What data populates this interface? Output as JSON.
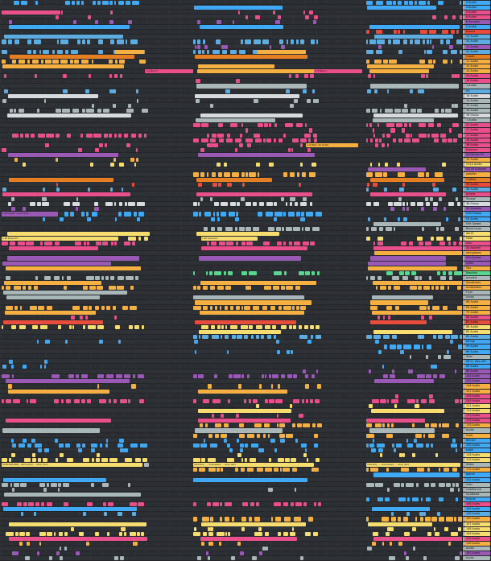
{
  "tracks": [
    {
      "name": "3 Audio",
      "color": "#3fa9f5"
    },
    {
      "name": "4 Audio",
      "color": "#3fa9f5"
    },
    {
      "name": "5 Audio",
      "color": "#e94f8a"
    },
    {
      "name": "6 Audio",
      "color": "#e94f8a"
    },
    {
      "name": "8 Sampler",
      "color": "#9b59b6"
    },
    {
      "name": "5 Audio",
      "color": "#3fa9f5"
    },
    {
      "name": "Drums",
      "color": "#e74c3c"
    },
    {
      "name": "10 Audio",
      "color": "#5dade2"
    },
    {
      "name": "14 Audio",
      "color": "#5dade2"
    },
    {
      "name": "12 Audio",
      "color": "#9b59b6"
    },
    {
      "name": "12 Audio",
      "color": "#5dade2"
    },
    {
      "name": "rvsper",
      "color": "#e67e22"
    },
    {
      "name": "11 Audio",
      "color": "#f5b041"
    },
    {
      "name": "13 Audio",
      "color": "#f5b041"
    },
    {
      "name": "14 Audio",
      "color": "#f5b041"
    },
    {
      "name": "15 Audio",
      "color": "#e94f8a"
    },
    {
      "name": "16 Audio",
      "color": "#e94f8a"
    },
    {
      "name": "1-Audio",
      "color": "#aab7b8"
    },
    {
      "name": "Hh",
      "color": "#5dade2"
    },
    {
      "name": "16 Audio",
      "color": "#d7dbdd"
    },
    {
      "name": "14 Audio",
      "color": "#aab7b8"
    },
    {
      "name": "15 Audio",
      "color": "#aab7b8"
    },
    {
      "name": "16 Audio",
      "color": "#aab7b8"
    },
    {
      "name": "16 Group",
      "color": "#d7dbdd"
    },
    {
      "name": "1 Audio",
      "color": "#aab7b8"
    },
    {
      "name": "22 Audio",
      "color": "#e94f8a"
    },
    {
      "name": "17 Audio",
      "color": "#e94f8a"
    },
    {
      "name": "17 Audio",
      "color": "#e94f8a"
    },
    {
      "name": "18 Audio",
      "color": "#e94f8a"
    },
    {
      "name": "36 Audio",
      "color": "#e94f8a"
    },
    {
      "name": "Anamnu",
      "color": "#e94f8a"
    },
    {
      "name": "24 Drums Ell",
      "color": "#9b59b6"
    },
    {
      "name": "19 Audio",
      "color": "#f5b041"
    },
    {
      "name": "Ch10 Audio",
      "color": "#f7dc6f"
    },
    {
      "name": "SN 34 Autosite",
      "color": "#9b59b6"
    },
    {
      "name": "pad/ber",
      "color": "#f5b041"
    },
    {
      "name": "OutPad",
      "color": "#e67e22"
    },
    {
      "name": "33 Audio",
      "color": "#e74c3c"
    },
    {
      "name": "36 Audio",
      "color": "#5dade2"
    },
    {
      "name": "Amplis",
      "color": "#e94f8a"
    },
    {
      "name": "Sinage",
      "color": "#aab7b8"
    },
    {
      "name": "36 Group",
      "color": "#d7dbdd"
    },
    {
      "name": "36 Sampler",
      "color": "#9b59b6"
    },
    {
      "name": "Mild Sweep",
      "color": "#3fa9f5"
    },
    {
      "name": "53 Audio",
      "color": "#3fa9f5"
    },
    {
      "name": "Edit Sweps",
      "color": "#aab7b8"
    },
    {
      "name": "Black Lines",
      "color": "#aab7b8"
    },
    {
      "name": "Xel15",
      "color": "#f7dc6f"
    },
    {
      "name": "Hate",
      "color": "#f7dc6f"
    },
    {
      "name": "Snin",
      "color": "#e94f8a"
    },
    {
      "name": "34 Asthmil",
      "color": "#e94f8a"
    },
    {
      "name": "stringdown",
      "color": "#f5b041"
    },
    {
      "name": "Hor-Syntes",
      "color": "#9b59b6"
    },
    {
      "name": "synth",
      "color": "#9b59b6"
    },
    {
      "name": "Sax",
      "color": "#f5b041"
    },
    {
      "name": "Bassline",
      "color": "#58d68d"
    },
    {
      "name": "preview",
      "color": "#aab7b8"
    },
    {
      "name": "Sandtunes",
      "color": "#f5b041"
    },
    {
      "name": "Audiovision",
      "color": "#f5b041"
    },
    {
      "name": "Flyer",
      "color": "#aab7b8"
    },
    {
      "name": "Audio",
      "color": "#aab7b8"
    },
    {
      "name": "8B Audio",
      "color": "#f5b041"
    },
    {
      "name": "69 Audio",
      "color": "#f5b041"
    },
    {
      "name": "79 Audio",
      "color": "#f5b041"
    },
    {
      "name": "88 Audio",
      "color": "#e94f8a"
    },
    {
      "name": "82 Audio",
      "color": "#e74c3c"
    },
    {
      "name": "88 Audio",
      "color": "#f7dc6f"
    },
    {
      "name": "83 Audio",
      "color": "#f7dc6f"
    },
    {
      "name": "82 Audio",
      "color": "#5dade2"
    },
    {
      "name": "tempo",
      "color": "#3fa9f5"
    },
    {
      "name": "90 Audio",
      "color": "#3fa9f5"
    },
    {
      "name": "99 Audio",
      "color": "#3fa9f5"
    },
    {
      "name": "Stab",
      "color": "#aab7b8"
    },
    {
      "name": "98 I2, bien aftr",
      "color": "#3fa9f5"
    },
    {
      "name": "89 Audio",
      "color": "#3fa9f5"
    },
    {
      "name": "98 Audio",
      "color": "#9b59b6"
    },
    {
      "name": "104 Audio",
      "color": "#9b59b6"
    },
    {
      "name": "105 Audio",
      "color": "#9b59b6"
    },
    {
      "name": "108 Audio",
      "color": "#f5b041"
    },
    {
      "name": "107 Audio",
      "color": "#f5b041"
    },
    {
      "name": "108 Audio",
      "color": "#e94f8a"
    },
    {
      "name": "109 Audio",
      "color": "#e94f8a"
    },
    {
      "name": "111 Audio",
      "color": "#f7dc6f"
    },
    {
      "name": "112 Audio",
      "color": "#f7dc6f"
    },
    {
      "name": "113 Audio",
      "color": "#e94f8a"
    },
    {
      "name": "116 Audio",
      "color": "#e94f8a"
    },
    {
      "name": "118 Audio",
      "color": "#f5b041"
    },
    {
      "name": "Audio",
      "color": "#aab7b8"
    },
    {
      "name": "fsmb",
      "color": "#f5b041"
    },
    {
      "name": "Winder",
      "color": "#3fa9f5"
    },
    {
      "name": "135 Audio",
      "color": "#3fa9f5"
    },
    {
      "name": "fxdbt",
      "color": "#3fa9f5"
    },
    {
      "name": "128 Audio",
      "color": "#f7dc6f"
    },
    {
      "name": "125 Audio",
      "color": "#f7dc6f"
    },
    {
      "name": "Stabs",
      "color": "#aab7b8"
    },
    {
      "name": "115 Audio",
      "color": "#f5b041"
    },
    {
      "name": "batrim",
      "color": "#3fa9f5"
    },
    {
      "name": "132 Audio",
      "color": "#3fa9f5"
    },
    {
      "name": "rider",
      "color": "#aab7b8"
    },
    {
      "name": "LeadSound",
      "color": "#aab7b8"
    },
    {
      "name": "SickBeast",
      "color": "#aab7b8"
    },
    {
      "name": "Sharks",
      "color": "#3fa9f5"
    },
    {
      "name": "146 Audio",
      "color": "#e94f8a"
    },
    {
      "name": "149 Audio",
      "color": "#3fa9f5"
    },
    {
      "name": "148 Audio",
      "color": "#5dade2"
    },
    {
      "name": "160 Audio",
      "color": "#f5b041"
    },
    {
      "name": "147 Audio",
      "color": "#f7dc6f"
    },
    {
      "name": "148 Audio",
      "color": "#f7dc6f"
    },
    {
      "name": "149 Audio",
      "color": "#f7dc6f"
    },
    {
      "name": "150 Audio",
      "color": "#e94f8a"
    },
    {
      "name": "148 Audio",
      "color": "#f5b041"
    },
    {
      "name": "Audio",
      "color": "#aab7b8"
    },
    {
      "name": "160 Audio",
      "color": "#9b59b6"
    },
    {
      "name": "Audio",
      "color": "#aab7b8"
    }
  ],
  "clip_labels": {
    "intro_left": "ATMOSPHERE_ Gbrushed ... Amp Vero",
    "intro_mid": "VOCALS_ ... dveraelvd ... amp Vero",
    "intro_right": "VOCALS_ ... dveraelvd ... amp Vero",
    "bass_left": "1 Bl Scenario",
    "bass_mid": "1 Bl Scenario",
    "macro_a": "1-4 Macro",
    "macro_b": "1-4 Macro",
    "drums_a": "1.0k Synth 1.0k Synth",
    "pad_a": "1 Bl Pad",
    "lead_a": "1 Bl Rhodes",
    "texture_a": "1-3 Texture",
    "main_mid": "1-4 Main 10 Audio",
    "outro": "VOCALS_ ... dveraelvd ... amp Vero"
  },
  "colors": {
    "pink": "#e94f8a",
    "magenta": "#d35eb6",
    "orange": "#f5b041",
    "yellow": "#f7dc6f",
    "blue": "#3fa9f5",
    "cyan": "#48c9e0",
    "purple": "#9b59b6",
    "red": "#e74c3c",
    "green": "#58d68d",
    "grey": "#aab7b8",
    "white": "#e8e8e8"
  }
}
